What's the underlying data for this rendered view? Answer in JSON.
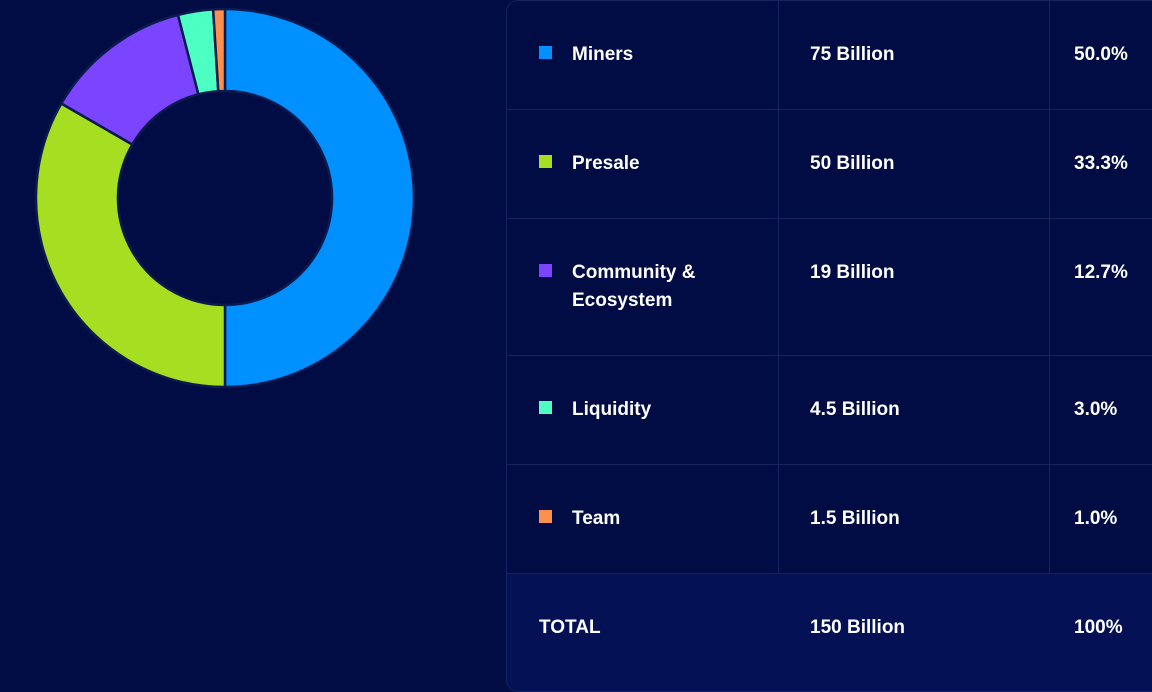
{
  "chart_data": {
    "type": "pie",
    "variant": "donut",
    "categories": [
      "Miners",
      "Presale",
      "Community & Ecosystem",
      "Liquidity",
      "Team"
    ],
    "values": [
      75,
      50,
      19,
      4.5,
      1.5
    ],
    "amount_labels": [
      "75 Billion",
      "50 Billion",
      "19 Billion",
      "4.5 Billion",
      "1.5 Billion"
    ],
    "percent_labels": [
      "50.0%",
      "33.3%",
      "12.7%",
      "3.0%",
      "1.0%"
    ],
    "colors": [
      "#0090ff",
      "#a6de22",
      "#7b45ff",
      "#4dffc3",
      "#ff8f4d"
    ],
    "legend": "table-right"
  },
  "table": {
    "rows": [
      {
        "name": "Miners",
        "amount": "75 Billion",
        "percent": "50.0%",
        "color": "#0090ff"
      },
      {
        "name": "Presale",
        "amount": "50 Billion",
        "percent": "33.3%",
        "color": "#a6de22"
      },
      {
        "name": "Community &",
        "name2": "Ecosystem",
        "amount": "19 Billion",
        "percent": "12.7%",
        "color": "#7b45ff"
      },
      {
        "name": "Liquidity",
        "amount": "4.5 Billion",
        "percent": "3.0%",
        "color": "#4dffc3"
      },
      {
        "name": "Team",
        "amount": "1.5 Billion",
        "percent": "1.0%",
        "color": "#ff8f4d"
      }
    ],
    "total": {
      "label": "TOTAL",
      "amount": "150 Billion",
      "percent": "100%"
    }
  },
  "colors": {
    "background": "#000c43",
    "total_row": "#041255",
    "border": "#14245f"
  }
}
